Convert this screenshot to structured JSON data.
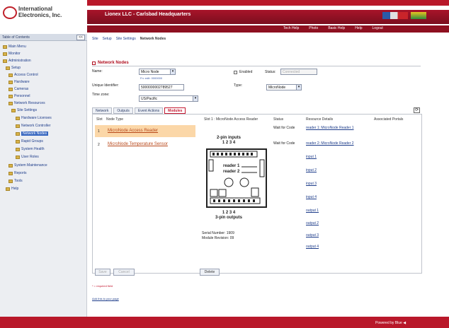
{
  "header": {
    "logo_line1": "International",
    "logo_line2": "Electronics, Inc.",
    "company": "Lionex LLC - Carlsbad Headquarters",
    "links": [
      "Tech Help",
      "Photo",
      "Basic Help",
      "Help",
      "Logout"
    ]
  },
  "sidebar": {
    "heading": "Table of Contents",
    "collapse": "<<",
    "items": [
      {
        "label": "Main Menu"
      },
      {
        "label": "Monitor"
      },
      {
        "label": "Administration"
      },
      {
        "label": "Setup"
      },
      {
        "label": "Access Control"
      },
      {
        "label": "Hardware"
      },
      {
        "label": "Cameras"
      },
      {
        "label": "Personnel"
      },
      {
        "label": "Network Resources"
      },
      {
        "label": "Site Settings"
      },
      {
        "label": "Hardware Licenses"
      },
      {
        "label": "Network Controller"
      },
      {
        "label": "Network Nodes"
      },
      {
        "label": "Rapid Groups"
      },
      {
        "label": "System Health"
      },
      {
        "label": "User Roles"
      },
      {
        "label": "System Maintenance"
      },
      {
        "label": "Reports"
      },
      {
        "label": "Tools"
      },
      {
        "label": "Help"
      }
    ]
  },
  "breadcrumbs": [
    "Site",
    "Setup",
    "Site Settings",
    "Network Nodes"
  ],
  "section": {
    "title": "Network Nodes"
  },
  "form": {
    "name_label": "Name:",
    "name_value": "Micro Node",
    "name_hint": "Fn: edit: 0000000",
    "serial_label": "Unique Identifier:",
    "serial_value": "5000000002789527",
    "timezone_label": "Time zone:",
    "timezone_value": "US/Pacific",
    "enabled_label": "Enabled",
    "status_label": "Status:",
    "status_value": "Connected",
    "type_label": "Type:",
    "type_value": "MicroNode"
  },
  "tabs": [
    "Network",
    "Outputs",
    "Event Actions",
    "Modules"
  ],
  "active_tab": 3,
  "table": {
    "headers": [
      "Slot",
      "Node Type",
      "Slot 1 : MicroNode Access Reader",
      "Status",
      "Resource Details",
      "Associated Portals"
    ],
    "rows": [
      {
        "slot": "1",
        "type": "MicroNode Access Reader",
        "status": "Wait for Code"
      },
      {
        "slot": "2",
        "type": "MicroNode Temperature Sensor",
        "status": "Wait for Code"
      }
    ]
  },
  "resources": [
    "reader 1: MicroNode Reader 1",
    "reader 2: MicroNode Reader 2",
    "input 1",
    "input 2",
    "input 3",
    "input 4",
    "output 1",
    "output 2",
    "output 3",
    "output 4"
  ],
  "module": {
    "inputs_title": "2-pin inputs",
    "inputs_numbers": "1  2  3  4",
    "reader1": "reader 1",
    "reader2": "reader 2",
    "outputs_numbers": "1  2  3  4",
    "outputs_title": "3-pin outputs",
    "serial_line": "Serial Number: 1909",
    "revision_line": "Module Revision: 09"
  },
  "buttons": {
    "save": "Save",
    "cancel": "Cancel",
    "delete": "Delete"
  },
  "required_note": "* = required field",
  "add_link": "Add this to your page",
  "footer": {
    "text": "Powered by Blue ◀"
  }
}
